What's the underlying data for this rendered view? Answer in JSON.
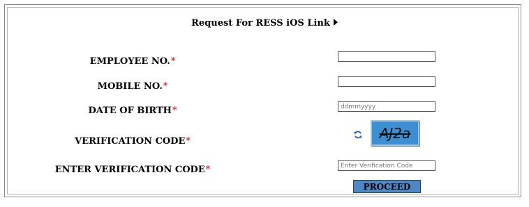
{
  "header": {
    "title": "Request For RESS iOS Link"
  },
  "form": {
    "required_marker": "*",
    "employee_no": {
      "label": "EMPLOYEE NO.",
      "value": "",
      "placeholder": ""
    },
    "mobile_no": {
      "label": "MOBILE NO.",
      "value": "",
      "placeholder": ""
    },
    "date_of_birth": {
      "label": "DATE OF BIRTH",
      "value": "",
      "placeholder": "ddmmyyyy"
    },
    "verification_code": {
      "label": "VERIFICATION CODE",
      "captcha_text": "AJ2a",
      "refresh_icon": "refresh-icon"
    },
    "enter_verification_code": {
      "label": "ENTER VERIFICATION CODE",
      "value": "",
      "placeholder": "Enter Verification Code"
    },
    "proceed_label": "PROCEED"
  },
  "colors": {
    "required": "#cc0000",
    "captcha_bg": "#3d8fd4",
    "proceed_bg": "#4f87c2",
    "refresh_icon": "#2255cc"
  }
}
